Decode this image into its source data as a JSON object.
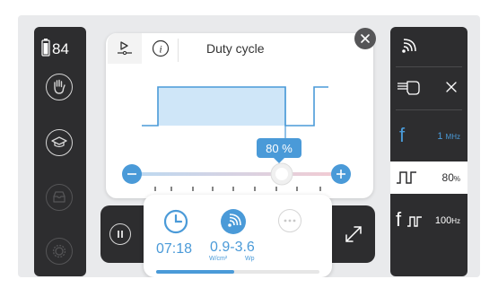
{
  "battery": {
    "level": "84"
  },
  "card": {
    "title": "Duty cycle"
  },
  "slider": {
    "value_label": "80 %",
    "value_percent": 80
  },
  "status": {
    "time": "07:18",
    "intensity_range": "0.9-3.6",
    "intensity_unit": "W/cm²",
    "power_unit": "Wp",
    "progress_fraction": 0.48
  },
  "settings": {
    "frequency": {
      "value": "1",
      "unit": "MHz"
    },
    "duty_cycle": {
      "value": "80",
      "unit": "%"
    },
    "pulse_frequency": {
      "value": "100",
      "unit": "Hz"
    }
  },
  "colors": {
    "accent": "#4a9ad8",
    "panel": "#2d2d2f",
    "background": "#e9eaec",
    "pulse_fill": "#cfe6f8"
  }
}
